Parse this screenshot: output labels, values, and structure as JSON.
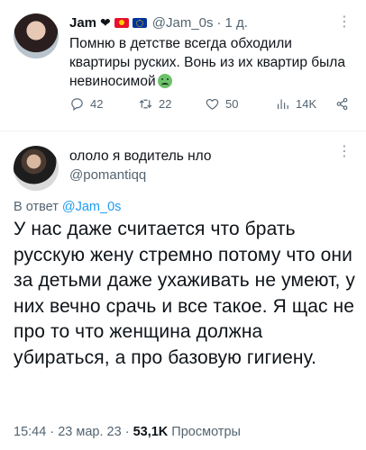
{
  "tweet1": {
    "display_name": "Jam",
    "handle": "@Jam_0s",
    "dot": "·",
    "time": "1 д.",
    "text": "Помню в детстве всегда обходили квартиры руских. Вонь из их квартир была невиносимой",
    "actions": {
      "replies": "42",
      "retweets": "22",
      "likes": "50",
      "views": "14K"
    },
    "icons": [
      "black-heart-icon",
      "kyrgyzstan-flag-icon",
      "eu-flag-icon",
      "sick-face-emoji-icon"
    ]
  },
  "tweet2": {
    "display_name": "ололо я водитель нло",
    "handle": "@pomantiqq",
    "reply_prefix": "В ответ ",
    "reply_handle": "@Jam_0s",
    "text": "У нас даже считается что брать русскую жену стремно потому что они за детьми даже ухаживать не умеют, у них вечно срачь и все такое. Я щас не про то что женщина должна убираться, а про базовую гигиену.",
    "time": "15:44",
    "date": "23 мар. 23",
    "sep": "·",
    "views_count": "53,1K",
    "views_label": "Просмотры"
  },
  "colors": {
    "text": "#0f1419",
    "secondary": "#536471",
    "link": "#1d9bf0",
    "divider": "#eff3f4"
  }
}
